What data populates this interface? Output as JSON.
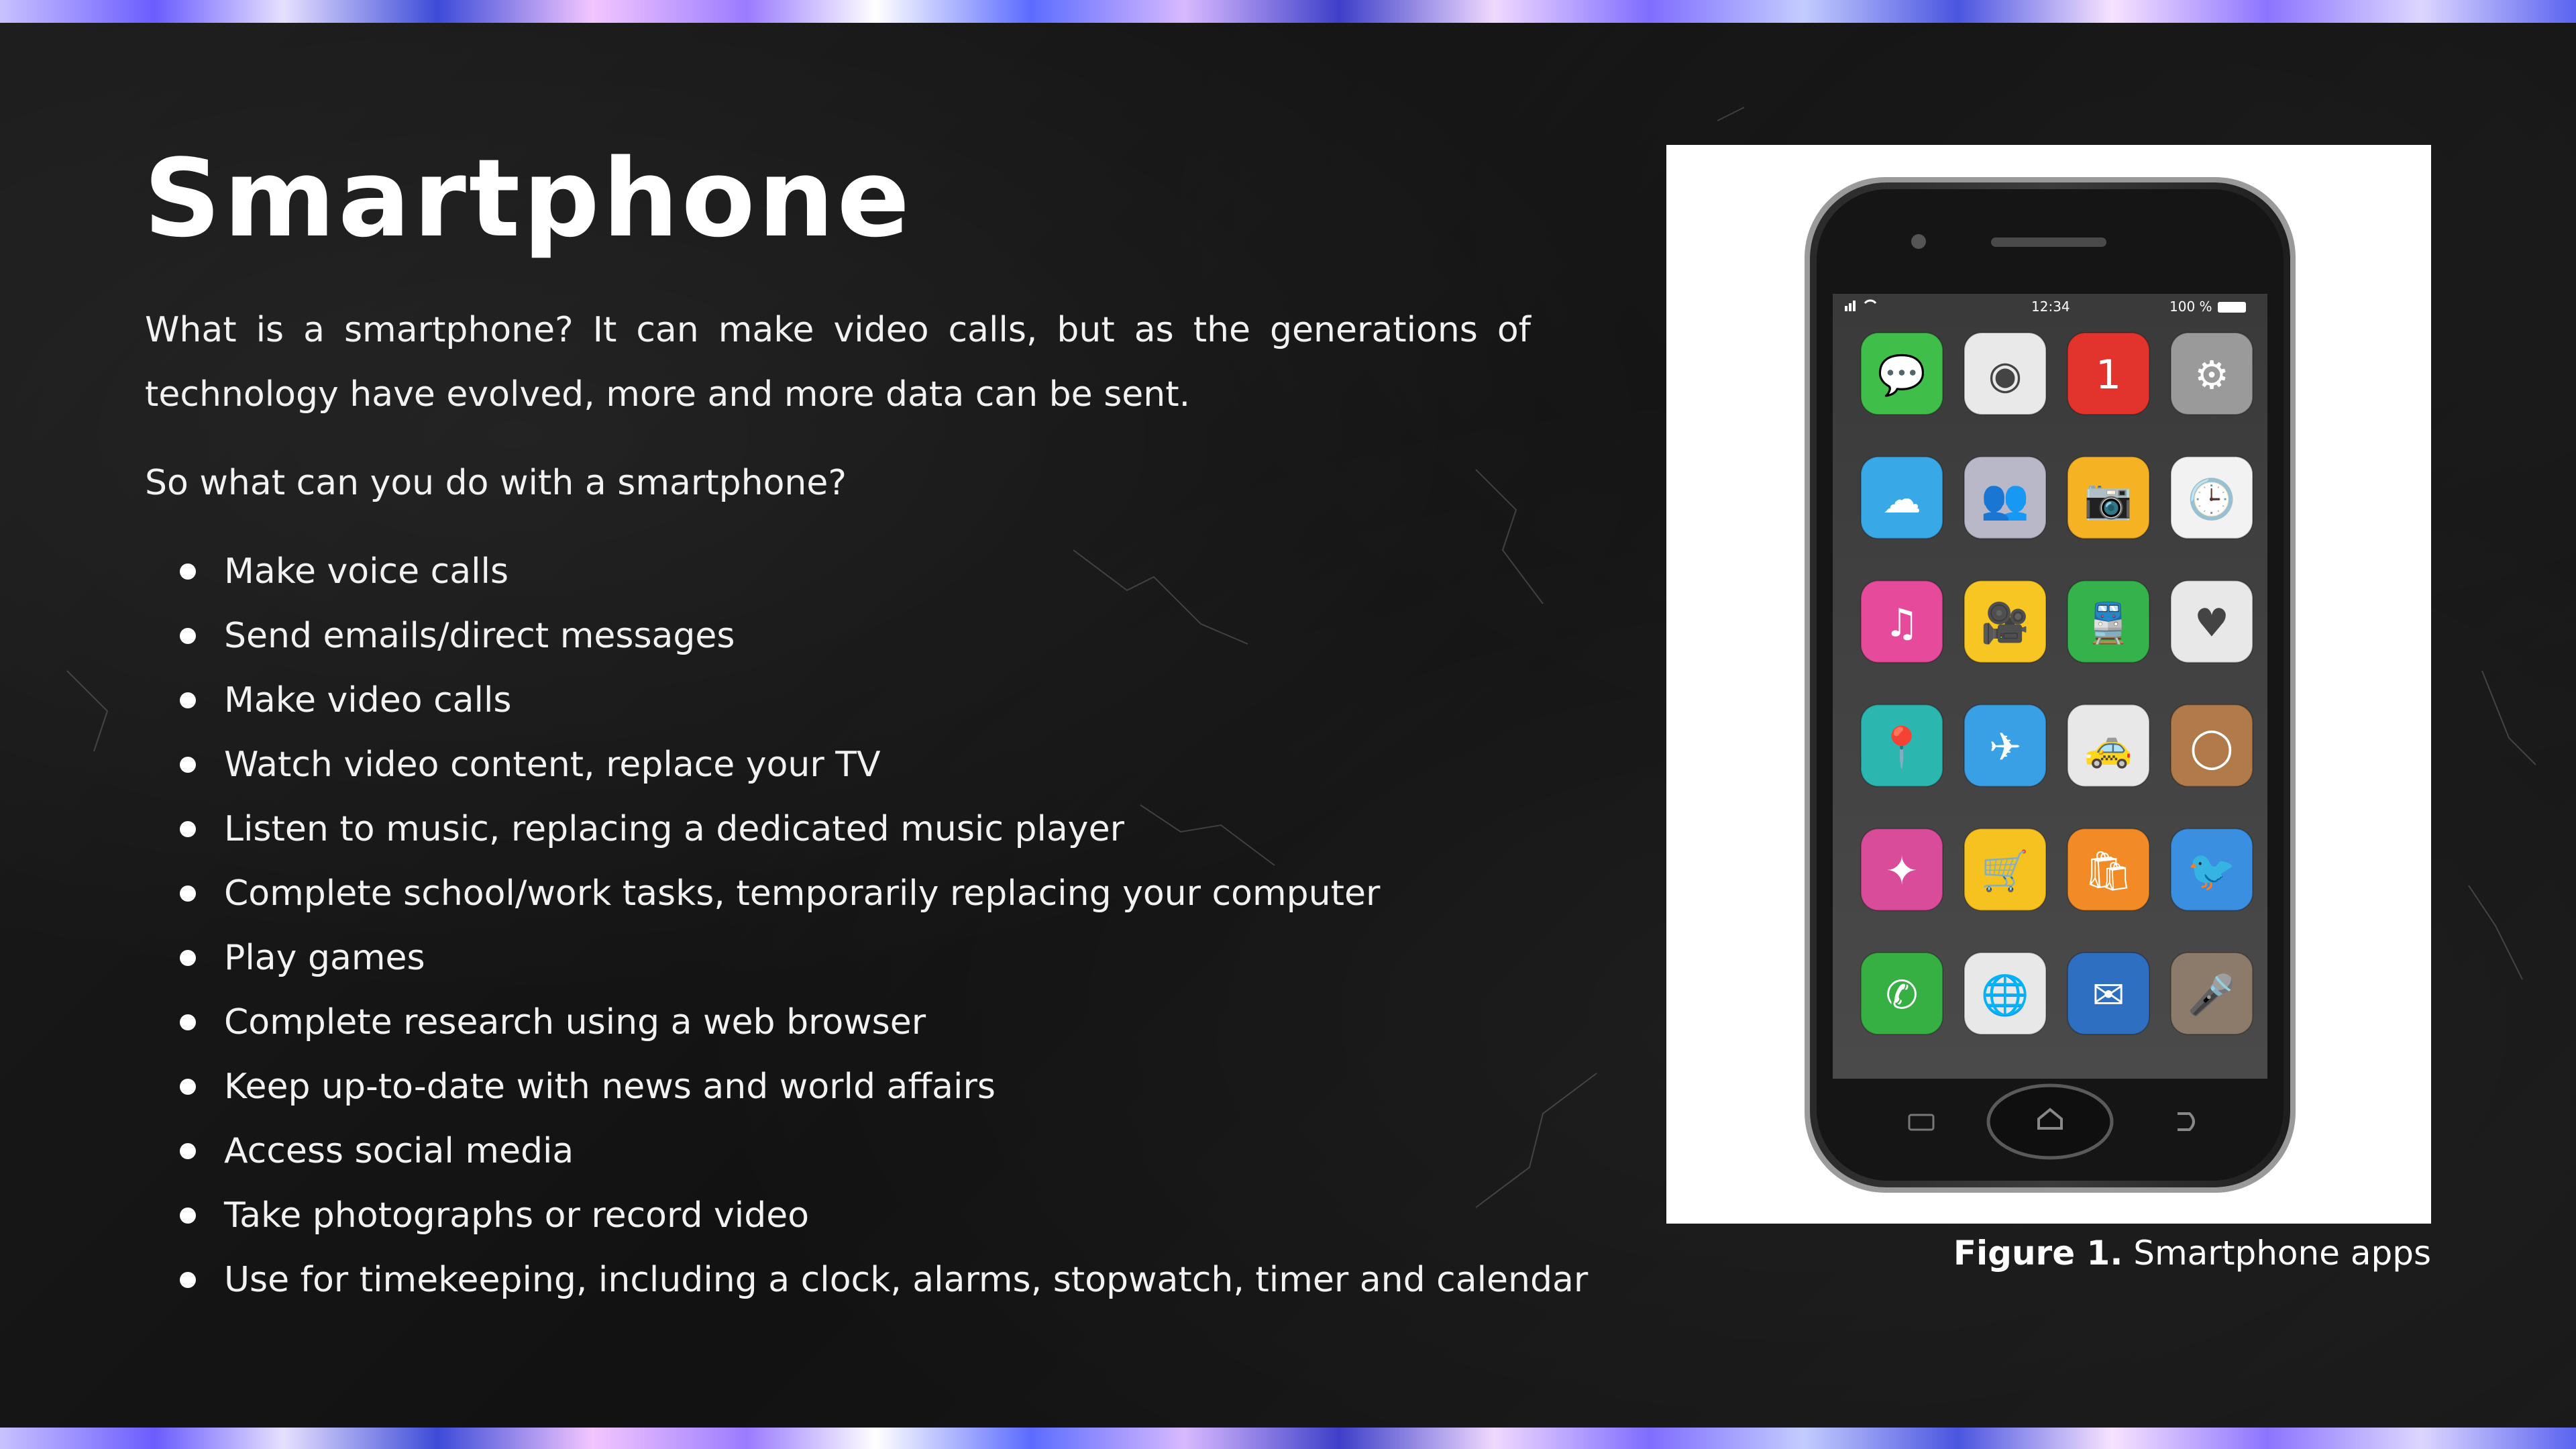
{
  "slide": {
    "title": "Smartphone",
    "intro_paragraph": "What is a smartphone? It can make video calls, but as the generations of technology have evolved, more and more data can be sent.",
    "question_paragraph": "So what can you do with a smartphone?",
    "bullets": [
      "Make voice calls",
      "Send emails/direct messages",
      "Make video calls",
      "Watch video content, replace your TV",
      "Listen to music, replacing a dedicated music player",
      "Complete school/work tasks, temporarily replacing your computer",
      "Play games",
      "Complete research using a web browser",
      "Keep up-to-date with news and world affairs",
      "Access social media",
      "Take photographs or record video",
      "Use for timekeeping, including a clock, alarms, stopwatch, timer and calendar"
    ]
  },
  "figure": {
    "caption_label": "Figure 1.",
    "caption_text": " Smartphone apps",
    "status_time": "12:34",
    "status_battery": "100 %",
    "calendar_day": "1",
    "app_icons": [
      [
        "chat-icon",
        "color-wheel-icon",
        "calendar-icon",
        "settings-gear-icon"
      ],
      [
        "weather-icon",
        "contacts-icon",
        "camera-icon",
        "clock-icon"
      ],
      [
        "music-note-icon",
        "video-camera-icon",
        "train-icon",
        "health-heart-icon"
      ],
      [
        "map-pin-icon",
        "airplane-icon",
        "taxi-icon",
        "watch-icon"
      ],
      [
        "disco-ball-icon",
        "shopping-cart-icon",
        "shopping-bag-icon",
        "bird-icon"
      ],
      [
        "phone-icon",
        "globe-icon",
        "mail-icon",
        "microphone-icon"
      ]
    ],
    "app_colors": [
      [
        "#3fbf4a",
        "#e9e9e9",
        "#e2342d",
        "#9a9a9a"
      ],
      [
        "#39a8e6",
        "#b8b8c8",
        "#f5b223",
        "#f2f2f2"
      ],
      [
        "#e64a9b",
        "#f7c623",
        "#35b24b",
        "#e8e8e8"
      ],
      [
        "#2bb6b0",
        "#3aa0e6",
        "#e8e8e8",
        "#b07a4a"
      ],
      [
        "#d94c9a",
        "#f5c21f",
        "#f28a26",
        "#3b8fe0"
      ],
      [
        "#36b043",
        "#e8e8e8",
        "#2f6fc2",
        "#8c7a6a"
      ]
    ]
  }
}
